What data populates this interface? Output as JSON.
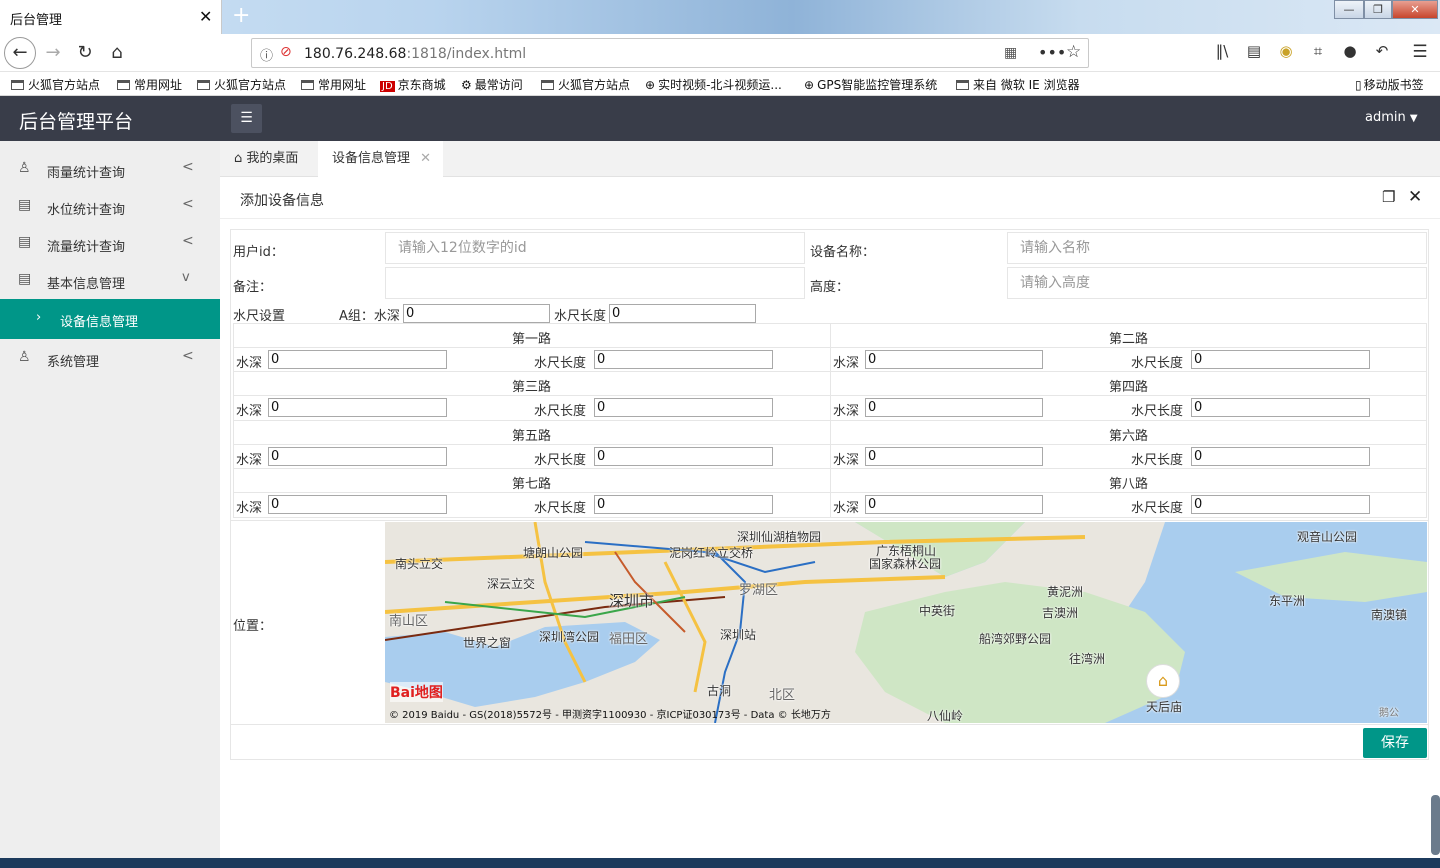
{
  "browser": {
    "tab_title": "后台管理",
    "tab_close": "✕",
    "new_tab": "+",
    "url_host": "180.76.248.68",
    "url_path": ":1818/index.html",
    "window_buttons": [
      "—",
      "❐",
      "✕"
    ],
    "bookmarks": [
      "火狐官方站点",
      "常用网址",
      "火狐官方站点",
      "常用网址",
      "京东商城",
      "最常访问",
      "火狐官方站点",
      "实时视频-北斗视频运...",
      "GPS智能监控管理系统",
      "来自 微软 IE 浏览器"
    ],
    "mobile_bookmarks": "移动版书签"
  },
  "app": {
    "title": "后台管理平台",
    "user": "admin",
    "accent_color": "#009688",
    "header_color": "#393d49"
  },
  "sidebar": {
    "items": [
      {
        "label": "雨量统计查询",
        "icon": "user-icon",
        "arrow": "<"
      },
      {
        "label": "水位统计查询",
        "icon": "doc-icon",
        "arrow": "<"
      },
      {
        "label": "流量统计查询",
        "icon": "doc-icon",
        "arrow": "<"
      },
      {
        "label": "基本信息管理",
        "icon": "doc-icon",
        "arrow": "v"
      },
      {
        "label": "设备信息管理",
        "icon": "chevron-right-icon",
        "active": true
      },
      {
        "label": "系统管理",
        "icon": "user-icon",
        "arrow": "<"
      }
    ]
  },
  "tabs": [
    {
      "label": "我的桌面",
      "icon": "home-icon"
    },
    {
      "label": "设备信息管理",
      "active": true
    }
  ],
  "panel": {
    "title": "添加设备信息"
  },
  "form": {
    "user_id_label": "用户id：",
    "user_id_placeholder": "请输入12位数字的id",
    "device_name_label": "设备名称：",
    "device_name_placeholder": "请输入名称",
    "remark_label": "备注：",
    "height_label": "高度：",
    "height_placeholder": "请输入高度",
    "gauge_settings_label": "水尺设置",
    "group_a_depth_label": "A组：水深",
    "group_a_depth_value": "0",
    "group_a_length_label": "水尺长度",
    "group_a_length_value": "0",
    "depth_label": "水深",
    "length_label": "水尺长度",
    "routes": [
      {
        "name": "第一路",
        "depth": "0",
        "length": "0"
      },
      {
        "name": "第二路",
        "depth": "0",
        "length": "0"
      },
      {
        "name": "第三路",
        "depth": "0",
        "length": "0"
      },
      {
        "name": "第四路",
        "depth": "0",
        "length": "0"
      },
      {
        "name": "第五路",
        "depth": "0",
        "length": "0"
      },
      {
        "name": "第六路",
        "depth": "0",
        "length": "0"
      },
      {
        "name": "第七路",
        "depth": "0",
        "length": "0"
      },
      {
        "name": "第八路",
        "depth": "0",
        "length": "0"
      }
    ],
    "location_label": "位置：",
    "save_label": "保存"
  },
  "map": {
    "labels": [
      "深圳仙湖植物园",
      "观音山公园",
      "塘朗山公园",
      "泥岗红岭立交桥",
      "广东梧桐山",
      "国家森林公园",
      "南头立交",
      "深云立交",
      "罗湖区",
      "深圳市",
      "黄泥洲",
      "吉澳洲",
      "东平洲",
      "南澳镇",
      "南山区",
      "中英街",
      "深圳湾公园",
      "福田区",
      "深圳站",
      "世界之窗",
      "船湾郊野公园",
      "往湾洲",
      "古洞",
      "北区",
      "天后庙",
      "八仙岭",
      "鹅公"
    ],
    "logo": "Bai地图",
    "copyright": "© 2019 Baidu - GS(2018)5572号 - 甲测资字1100930 - 京ICP证030173号 - Data © 长地万方"
  }
}
